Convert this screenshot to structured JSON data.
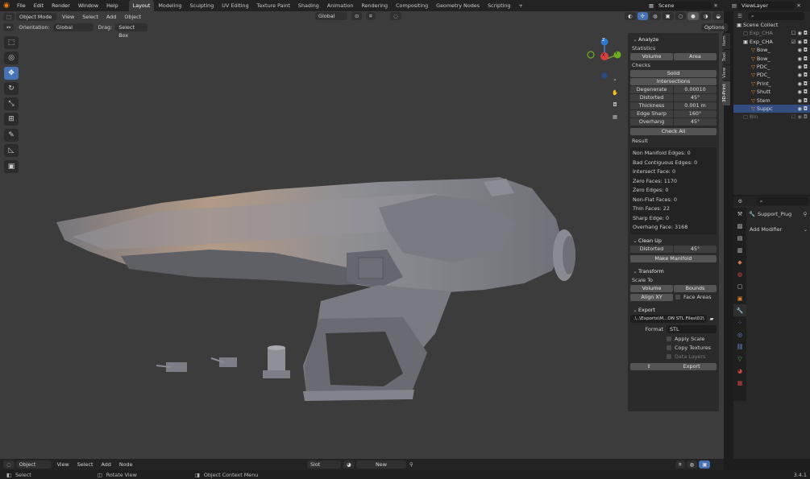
{
  "topbar": {
    "menus": [
      "File",
      "Edit",
      "Render",
      "Window",
      "Help"
    ],
    "workspaces": [
      "Layout",
      "Modeling",
      "Sculpting",
      "UV Editing",
      "Texture Paint",
      "Shading",
      "Animation",
      "Rendering",
      "Compositing",
      "Geometry Nodes",
      "Scripting"
    ],
    "active_workspace": "Layout",
    "add_tab": "+",
    "scene": "Scene",
    "view_layer": "ViewLayer"
  },
  "viewport_header": {
    "mode": "Object Mode",
    "menus": [
      "View",
      "Select",
      "Add",
      "Object"
    ],
    "transform_orientation": "Global"
  },
  "tool_header": {
    "orientation_label": "Orientation:",
    "orientation_value": "Global",
    "drag_label": "Drag:",
    "drag_value": "Select Box",
    "options": "Options"
  },
  "gizmo": {
    "x": "X",
    "y": "Y",
    "z": "Z"
  },
  "vtabs": [
    "Item",
    "Tool",
    "View",
    "3D-Print"
  ],
  "npanel": {
    "analyze": {
      "title": "Analyze",
      "statistics_label": "Statistics",
      "volume": "Volume",
      "area": "Area",
      "checks_label": "Checks",
      "solid": "Solid",
      "intersections": "Intersections",
      "checks": [
        {
          "label": "Degenerate",
          "value": "0.00010"
        },
        {
          "label": "Distorted",
          "value": "45°"
        },
        {
          "label": "Thickness",
          "value": "0.001 m"
        },
        {
          "label": "Edge Sharp",
          "value": "160°"
        },
        {
          "label": "Overhang",
          "value": "45°"
        }
      ],
      "check_all": "Check All",
      "result_label": "Result",
      "results": [
        "Non Manifold Edges: 0",
        "Bad Contiguous Edges: 0",
        "Intersect Face: 0",
        "Zero Faces: 1170",
        "Zero Edges: 0",
        "Non-Flat Faces: 0",
        "Thin Faces: 22",
        "Sharp Edge: 0",
        "Overhang Face: 3168"
      ]
    },
    "cleanup": {
      "title": "Clean Up",
      "distorted": "Distorted",
      "distorted_value": "45°",
      "make_manifold": "Make Manifold"
    },
    "transform": {
      "title": "Transform",
      "scale_to": "Scale To",
      "volume": "Volume",
      "bounds": "Bounds",
      "align_xy": "Align XY",
      "face_areas": "Face Areas"
    },
    "export": {
      "title": "Export",
      "path": ".\\..\\Exports\\M...ON STL Files\\02\\",
      "format_label": "Format",
      "format_value": "STL",
      "apply_scale": "Apply Scale",
      "copy_textures": "Copy Textures",
      "data_layers": "Data Layers",
      "export_button": "Export"
    }
  },
  "outliner": {
    "root": "Scene Collect",
    "items": [
      {
        "name": "Exp_CHA"
      },
      {
        "name": "Exp_CHA"
      },
      {
        "name": "Bow_"
      },
      {
        "name": "Bow_"
      },
      {
        "name": "PDC_"
      },
      {
        "name": "PDC_"
      },
      {
        "name": "Print_"
      },
      {
        "name": "Shutt"
      },
      {
        "name": "Stem"
      },
      {
        "name": "Suppc"
      },
      {
        "name": "Bin"
      }
    ]
  },
  "properties": {
    "object_name": "Support_Plug",
    "add_modifier": "Add Modifier"
  },
  "bottom_header": {
    "mode": "Object",
    "menus": [
      "View",
      "Select",
      "Add",
      "Node"
    ],
    "slot": "Slot",
    "new": "New"
  },
  "statusbar": {
    "select": "Select",
    "rotate_view": "Rotate View",
    "context_menu": "Object Context Menu",
    "version": "3.4.1"
  },
  "colors": {
    "accent": "#4772b3",
    "viewport": "#3c3c3c",
    "panel": "#2b2b2b",
    "model": "#8a8a92"
  }
}
